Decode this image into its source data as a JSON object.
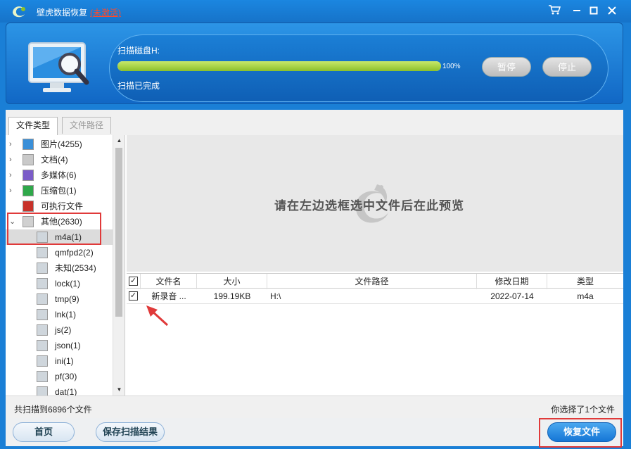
{
  "window": {
    "title": "壁虎数据恢复",
    "status": "(未激活)",
    "controls": [
      "cart-icon",
      "minimize-icon",
      "maximize-icon",
      "close-icon"
    ]
  },
  "scan": {
    "label": "扫描磁盘H:",
    "progress": 1.0,
    "progress_text": "100%",
    "status": "扫描已完成",
    "pause_label": "暂停",
    "stop_label": "停止"
  },
  "tabs": [
    {
      "label": "文件类型",
      "active": true
    },
    {
      "label": "文件路径",
      "active": false
    }
  ],
  "tree": [
    {
      "label": "图片(4255)",
      "icon": "image-icon",
      "expandable": true
    },
    {
      "label": "文档(4)",
      "icon": "document-icon",
      "expandable": true
    },
    {
      "label": "多媒体(6)",
      "icon": "music-icon",
      "expandable": true
    },
    {
      "label": "压缩包(1)",
      "icon": "archive-icon",
      "expandable": true
    },
    {
      "label": "可执行文件",
      "icon": "executable-icon",
      "expandable": false
    },
    {
      "label": "其他(2630)",
      "icon": "other-icon",
      "expandable": true,
      "expanded": true
    },
    {
      "label": "m4a(1)",
      "icon": "file-icon",
      "selected": true
    },
    {
      "label": "qmfpd2(2)",
      "icon": "file-icon"
    },
    {
      "label": "未知(2534)",
      "icon": "file-icon"
    },
    {
      "label": "lock(1)",
      "icon": "file-icon"
    },
    {
      "label": "tmp(9)",
      "icon": "file-icon"
    },
    {
      "label": "lnk(1)",
      "icon": "file-icon"
    },
    {
      "label": "js(2)",
      "icon": "file-icon"
    },
    {
      "label": "json(1)",
      "icon": "file-icon"
    },
    {
      "label": "ini(1)",
      "icon": "file-icon"
    },
    {
      "label": "pf(30)",
      "icon": "file-icon"
    },
    {
      "label": "dat(1)",
      "icon": "file-icon"
    }
  ],
  "preview": {
    "hint": "请在左边选框选中文件后在此预览"
  },
  "table": {
    "columns": [
      "文件名",
      "大小",
      "文件路径",
      "修改日期",
      "类型"
    ],
    "rows": [
      {
        "checked": true,
        "name": "新录音 ...",
        "size": "199.19KB",
        "path": "H:\\",
        "date": "2022-07-14",
        "type": "m4a"
      }
    ]
  },
  "status": {
    "left": "共扫描到6896个文件",
    "right": "你选择了1个文件"
  },
  "footer": {
    "home_label": "首页",
    "save_label": "保存扫描结果",
    "recover_label": "恢复文件"
  },
  "colors": {
    "accent": "#1a7fd6",
    "progress": "#a8d44a",
    "highlight": "#e03a3a",
    "unactivated": "#ff4a2a"
  }
}
